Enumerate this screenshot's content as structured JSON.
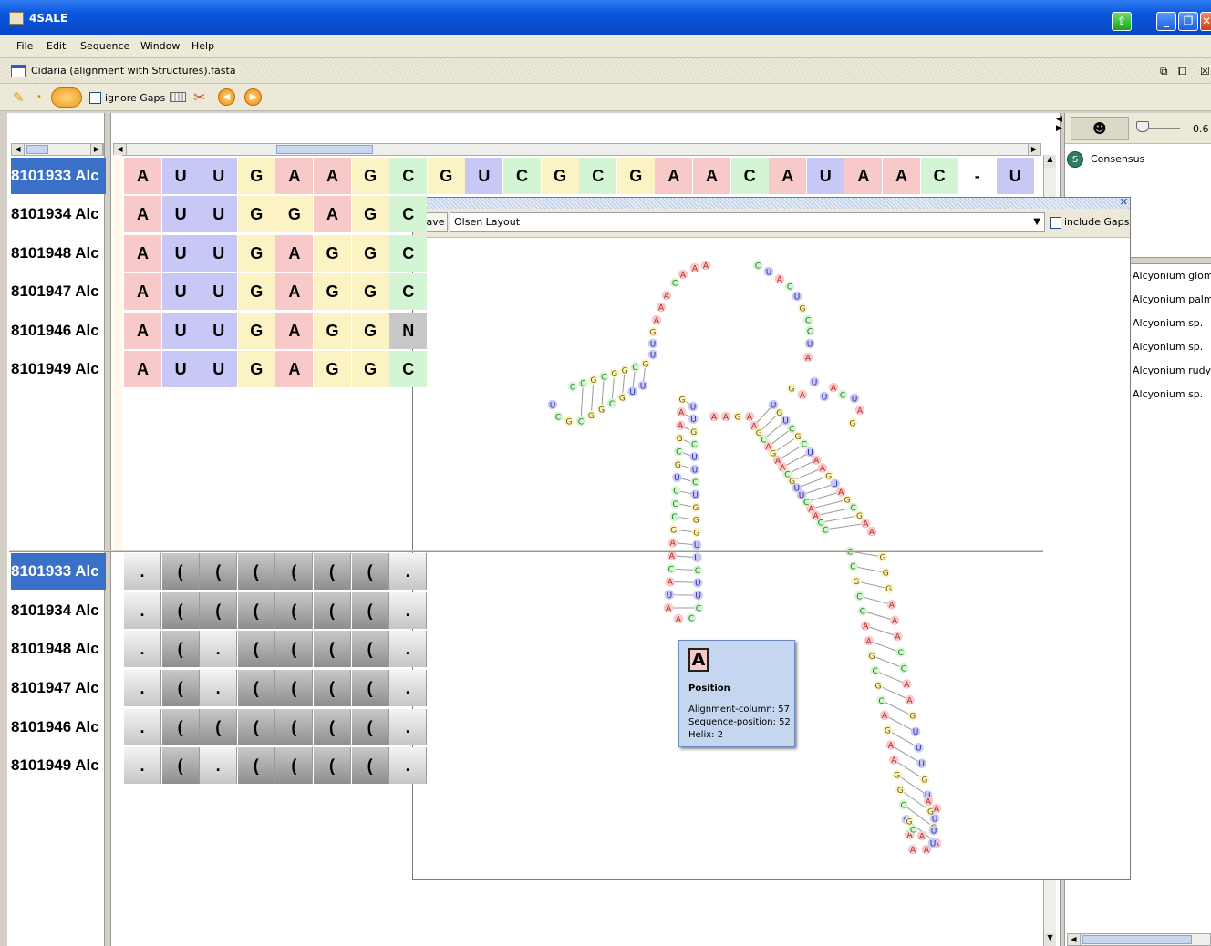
{
  "window": {
    "title": "4SALE"
  },
  "menu": [
    "File",
    "Edit",
    "Sequence",
    "Window",
    "Help"
  ],
  "document": {
    "title": "Cidaria (alignment with Structures).fasta",
    "icons": [
      "restore-icon",
      "detach-icon",
      "close-icon"
    ]
  },
  "toolbar": {
    "ignore_gaps_label": "ignore Gaps"
  },
  "sequences": [
    {
      "name": "8101933 Alc",
      "bases": [
        "A",
        "U",
        "U",
        "G",
        "A",
        "A",
        "G",
        "C",
        "G",
        "U",
        "C",
        "G",
        "C",
        "G",
        "A",
        "A",
        "C",
        "A",
        "U",
        "A",
        "A",
        "C",
        "-",
        "U"
      ],
      "structure": [
        ".",
        "(",
        "(",
        "(",
        "(",
        "(",
        "(",
        "."
      ]
    },
    {
      "name": "8101934 Alc",
      "bases": [
        "A",
        "U",
        "U",
        "G",
        "G",
        "A",
        "G",
        "C"
      ],
      "structure": [
        ".",
        "(",
        "(",
        "(",
        "(",
        "(",
        "(",
        "."
      ]
    },
    {
      "name": "8101948 Alc",
      "bases": [
        "A",
        "U",
        "U",
        "G",
        "A",
        "G",
        "G",
        "C"
      ],
      "structure": [
        ".",
        "(",
        ".",
        "(",
        "(",
        "(",
        "(",
        "."
      ]
    },
    {
      "name": "8101947 Alc",
      "bases": [
        "A",
        "U",
        "U",
        "G",
        "A",
        "G",
        "G",
        "C"
      ],
      "structure": [
        ".",
        "(",
        ".",
        "(",
        "(",
        "(",
        "(",
        "."
      ]
    },
    {
      "name": "8101946 Alc",
      "bases": [
        "A",
        "U",
        "U",
        "G",
        "A",
        "G",
        "G",
        "N"
      ],
      "structure": [
        ".",
        "(",
        "(",
        "(",
        "(",
        "(",
        "(",
        "."
      ]
    },
    {
      "name": "8101949 Alc",
      "bases": [
        "A",
        "U",
        "U",
        "G",
        "A",
        "G",
        "G",
        "C"
      ],
      "structure": [
        ".",
        "(",
        ".",
        "(",
        "(",
        "(",
        "(",
        "."
      ]
    }
  ],
  "base_colors": {
    "A": "#f7c9c9",
    "U": "#c8c8f6",
    "G": "#fbf3c4",
    "C": "#d3f5d3",
    "N": "#c8c8c8",
    "-": "#ffffff"
  },
  "structure_panel": {
    "consensus_label": "Consensus",
    "consensus_badge": "S",
    "slider_value": "0.6",
    "species": [
      "Alcyonium glomeratum",
      "Alcyonium palmatum",
      "Alcyonium sp.",
      "Alcyonium sp.",
      "Alcyonium rudyi",
      "Alcyonium sp."
    ]
  },
  "popup": {
    "save_label": "Save",
    "layout": "Olsen Layout",
    "include_gaps_label": "include Gaps"
  },
  "rna_letters": {
    "loop_left": [
      "A",
      "A",
      "A",
      "C",
      "A",
      "A",
      "A",
      "G",
      "U",
      "U"
    ],
    "loop_right": [
      "C",
      "U",
      "A",
      "C",
      "U",
      "G",
      "C",
      "C",
      "U",
      "A"
    ],
    "left_arm_top": [
      "G",
      "C",
      "G",
      "G",
      "C",
      "G",
      "C",
      "C"
    ],
    "left_arm_bottom": [
      "U",
      "U",
      "G",
      "C",
      "G",
      "G",
      "C"
    ],
    "stem1_left": [
      "G",
      "A",
      "A",
      "G",
      "C",
      "G",
      "U",
      "C",
      "C",
      "C",
      "G",
      "A",
      "A",
      "C",
      "A",
      "U",
      "A"
    ],
    "stem1_right": [
      "U",
      "U",
      "G",
      "C",
      "U",
      "U",
      "C",
      "U",
      "G",
      "G",
      "G",
      "U",
      "U",
      "C",
      "U",
      "U",
      "C"
    ],
    "stem2_left": [
      "A",
      "G",
      "C",
      "A",
      "G",
      "A",
      "A",
      "C",
      "G",
      "U",
      "U",
      "C",
      "A",
      "A",
      "C",
      "C"
    ],
    "stem2_right": [
      "U",
      "G",
      "U",
      "C",
      "G",
      "C",
      "U",
      "A",
      "A",
      "G",
      "U",
      "A",
      "G",
      "C",
      "G",
      "A",
      "A"
    ],
    "stem3_left": [
      "C",
      "C",
      "G",
      "C",
      "C",
      "A",
      "A",
      "G",
      "C",
      "G",
      "C",
      "A",
      "G",
      "A",
      "A",
      "G",
      "G",
      "C",
      "U",
      "A",
      "A"
    ],
    "stem3_right": [
      "G",
      "G",
      "G",
      "A",
      "A",
      "A",
      "C",
      "C",
      "A",
      "A",
      "G",
      "U",
      "U",
      "U",
      "G",
      "U",
      "G",
      "G",
      "A"
    ],
    "junction": [
      "A",
      "A",
      "G",
      "A"
    ],
    "right_hairpin": [
      "G",
      "A",
      "U",
      "U",
      "A",
      "C",
      "U",
      "A",
      "G"
    ],
    "hairpin_bottom": [
      "A",
      "A",
      "C",
      "G",
      "A",
      "A",
      "U",
      "U",
      "U"
    ]
  },
  "tooltip": {
    "base": "A",
    "heading": "Position",
    "alignment_column": "Alignment-column: 57",
    "sequence_position": "Sequence-position: 52",
    "helix": "Helix: 2"
  }
}
